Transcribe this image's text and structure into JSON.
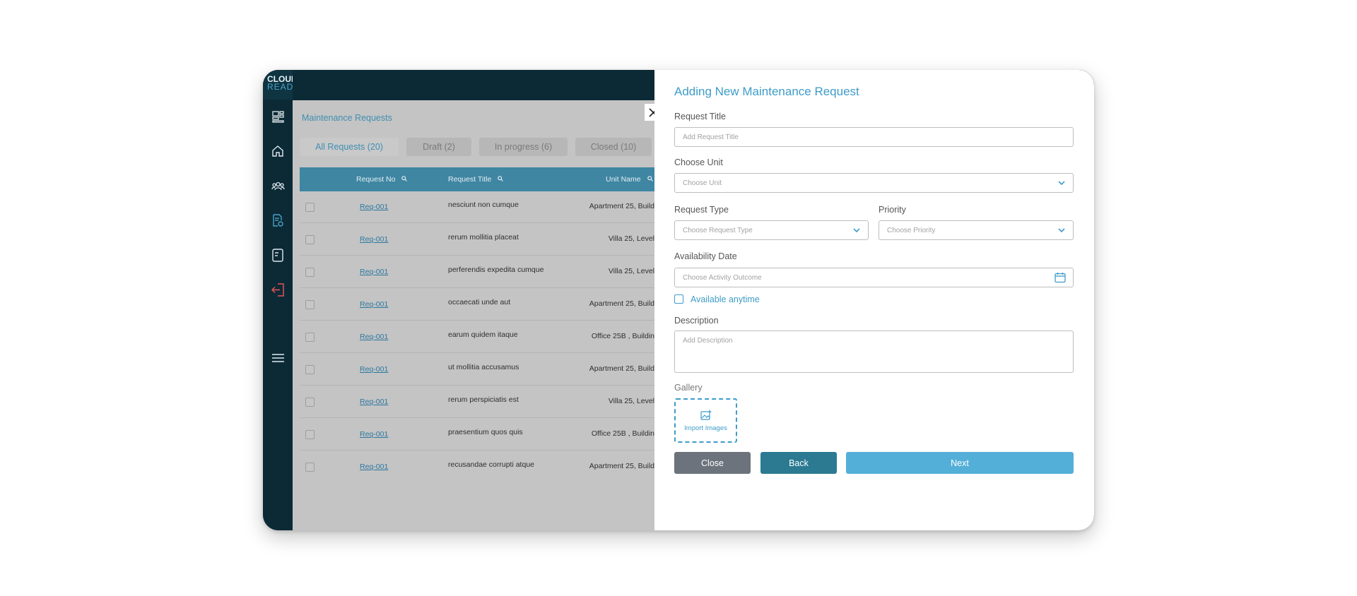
{
  "logo": {
    "line1": "CLOUD",
    "line2": "READY"
  },
  "sidebar": {
    "icons": [
      "dashboard-icon",
      "home-icon",
      "users-icon",
      "maintenance-doc-icon",
      "receipt-icon",
      "logout-icon",
      "menu-icon"
    ]
  },
  "main": {
    "breadcrumb": "Maintenance Requests",
    "tabs": [
      {
        "label": "All Requests (20)"
      },
      {
        "label": "Draft (2)"
      },
      {
        "label": "In progress (6)"
      },
      {
        "label": "Closed (10)"
      }
    ],
    "columns": [
      "Request No",
      "Request Title",
      "Unit Name"
    ],
    "rows": [
      {
        "no": "Req-001",
        "title": "nesciunt non cumque",
        "unit": "Apartment 25, Build"
      },
      {
        "no": "Req-001",
        "title": "rerum mollitia placeat",
        "unit": "Villa 25, Level"
      },
      {
        "no": "Req-001",
        "title": "perferendis expedita cumque",
        "unit": "Villa 25, Level"
      },
      {
        "no": "Req-001",
        "title": "occaecati unde aut",
        "unit": "Apartment 25, Build"
      },
      {
        "no": "Req-001",
        "title": "earum quidem itaque",
        "unit": "Office 25B , Buildin"
      },
      {
        "no": "Req-001",
        "title": "ut mollitia accusamus",
        "unit": "Apartment 25, Build"
      },
      {
        "no": "Req-001",
        "title": "rerum perspiciatis est",
        "unit": "Villa 25, Level"
      },
      {
        "no": "Req-001",
        "title": "praesentium quos quis",
        "unit": "Office 25B , Buildin"
      },
      {
        "no": "Req-001",
        "title": "recusandae corrupti atque",
        "unit": "Apartment 25, Build"
      }
    ]
  },
  "form": {
    "title": "Adding New Maintenance Request",
    "request_title_label": "Request Title",
    "request_title_placeholder": "Add Request Title",
    "unit_label": "Choose Unit",
    "unit_placeholder": "Choose Unit",
    "type_label": "Request Type",
    "type_placeholder": "Choose Request Type",
    "priority_label": "Priority",
    "priority_placeholder": "Choose Priority",
    "date_label": "Availability Date",
    "date_placeholder": "Choose Activity Outcome",
    "anytime_label": "Available anytime",
    "description_label": "Description",
    "description_placeholder": "Add Description",
    "gallery_label": "Gallery",
    "import_label": "Import Images",
    "close_label": "Close",
    "back_label": "Back",
    "next_label": "Next"
  },
  "colors": {
    "accent": "#3e9cc8",
    "dark": "#0c2a36",
    "close_btn": "#6c737c",
    "back_btn": "#2b7a92",
    "next_btn": "#54afd8"
  }
}
